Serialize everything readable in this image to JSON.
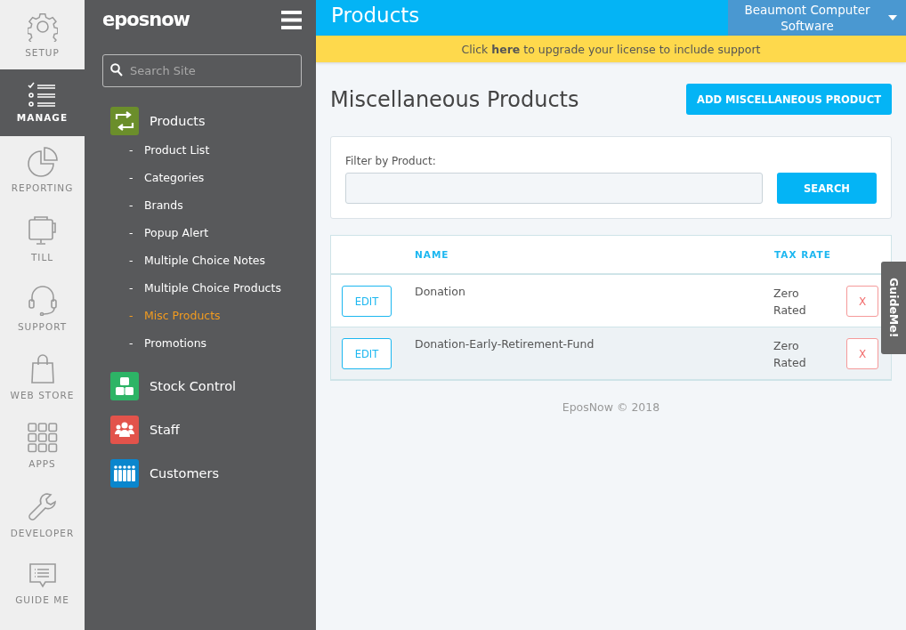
{
  "rail": [
    {
      "label": "SETUP",
      "kind": "gear",
      "selected": false
    },
    {
      "label": "MANAGE",
      "kind": "checklist",
      "selected": true
    },
    {
      "label": "REPORTING",
      "kind": "pie",
      "selected": false
    },
    {
      "label": "TILL",
      "kind": "till",
      "selected": false
    },
    {
      "label": "SUPPORT",
      "kind": "headset",
      "selected": false
    },
    {
      "label": "WEB STORE",
      "kind": "bag",
      "selected": false
    },
    {
      "label": "APPS",
      "kind": "grid",
      "selected": false
    },
    {
      "label": "DEVELOPER",
      "kind": "wrench",
      "selected": false
    },
    {
      "label": "GUIDE ME",
      "kind": "chat",
      "selected": false
    }
  ],
  "sidebar": {
    "logo": "eposnow",
    "search": {
      "placeholder": "Search Site"
    },
    "groups": [
      {
        "label": "Products",
        "kind": "arrows",
        "color": "#6b8e2b",
        "children": [
          {
            "bullet": "-",
            "label": "Product List",
            "selected": false
          },
          {
            "bullet": "-",
            "label": "Categories",
            "selected": false
          },
          {
            "bullet": "-",
            "label": "Brands",
            "selected": false
          },
          {
            "bullet": "-",
            "label": "Popup Alert",
            "selected": false
          },
          {
            "bullet": "-",
            "label": "Multiple Choice Notes",
            "selected": false
          },
          {
            "bullet": "-",
            "label": "Multiple Choice Products",
            "selected": false
          },
          {
            "bullet": "-",
            "label": "Misc Products",
            "selected": true
          },
          {
            "bullet": "-",
            "label": "Promotions",
            "selected": false
          }
        ]
      },
      {
        "label": "Stock Control",
        "kind": "boxes",
        "color": "#2db466"
      },
      {
        "label": "Staff",
        "kind": "people",
        "color": "#e2534b"
      },
      {
        "label": "Customers",
        "kind": "crowd",
        "color": "#0a86cd"
      }
    ]
  },
  "header": {
    "title": "Products",
    "account": "Beaumont Computer Software"
  },
  "banner": "Click **here** to upgrade your license to include support",
  "page_title": "Miscellaneous Products",
  "add_button": "ADD MISCELLANEOUS PRODUCT",
  "filter": {
    "label": "Filter by Product:",
    "button": "SEARCH"
  },
  "table": {
    "columns": [
      "NAME",
      "TAX RATE"
    ],
    "rows": [
      {
        "edit": "EDIT",
        "name": "Donation",
        "tax_rate": "Zero Rated",
        "delete": "X"
      },
      {
        "edit": "EDIT",
        "name": "Donation-Early-Retirement-Fund",
        "tax_rate": "Zero Rated",
        "delete": "X"
      }
    ]
  },
  "footer": "EposNow © 2018",
  "guide_tab": "GuideMe!"
}
